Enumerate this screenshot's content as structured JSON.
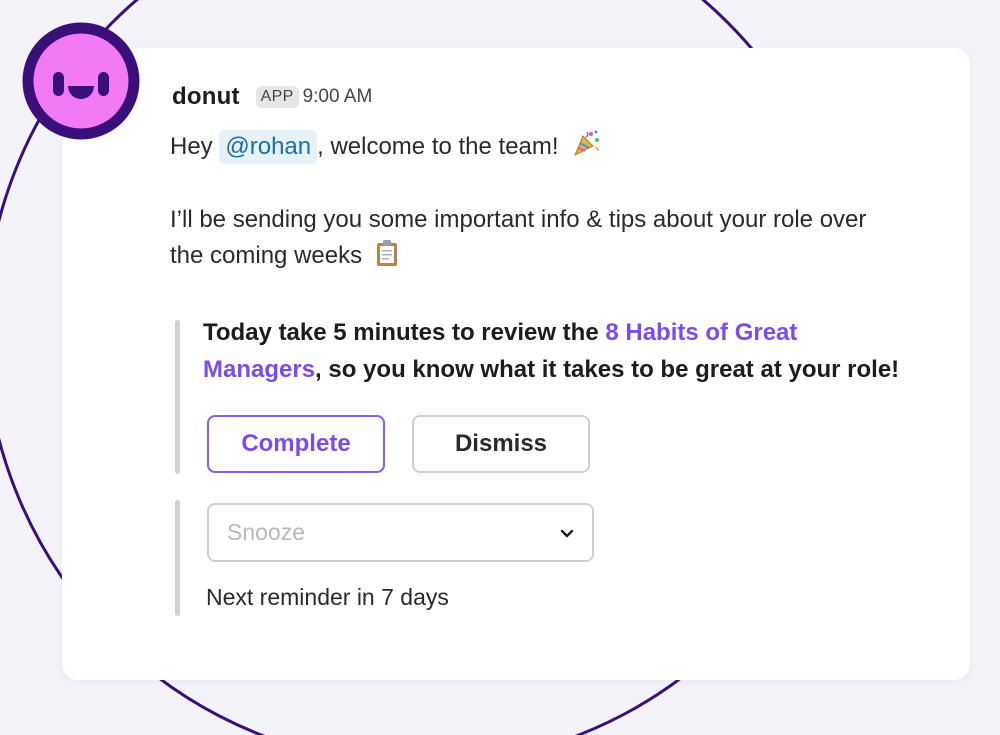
{
  "message": {
    "sender": "donut",
    "app_badge": "APP",
    "time": "9:00 AM",
    "greeting_prefix": "Hey",
    "mention": "@rohan",
    "greeting_suffix": ", welcome to the team!",
    "greeting_emoji": "party-popper-icon",
    "info_line1": "I’ll be sending you some important info & tips about your role over",
    "info_line2": "the coming weeks",
    "info_emoji": "clipboard-icon"
  },
  "tip": {
    "prefix": "Today take 5 minutes to review the ",
    "link_part1": "8 Habits of Great",
    "link_part2": "Managers",
    "suffix": ", so you know what it takes to be great at your role!"
  },
  "actions": {
    "complete_label": "Complete",
    "dismiss_label": "Dismiss"
  },
  "snooze": {
    "placeholder": "Snooze",
    "chevron_icon": "chevron-down-icon"
  },
  "reminder_text": "Next reminder in 7 days",
  "colors": {
    "accent_purple": "#7e4bea",
    "avatar_pink": "#f27bf5",
    "avatar_ring": "#3a0f7a",
    "mention_bg": "#e7f1f8",
    "mention_text": "#1a6fa8"
  }
}
